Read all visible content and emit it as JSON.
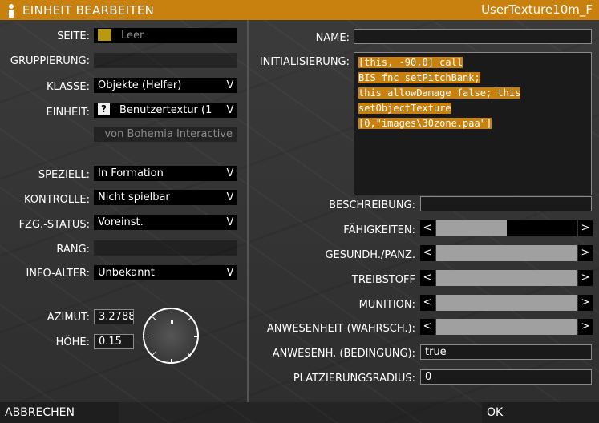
{
  "window": {
    "title": "EINHEIT BEARBEITEN",
    "object_name": "UserTexture10m_F",
    "accent_color": "#c8810e"
  },
  "left": {
    "seite": {
      "label": "SEITE:",
      "value": "Leer",
      "swatch_color": "#b89a10"
    },
    "gruppierung": {
      "label": "GRUPPIERUNG:",
      "value": ""
    },
    "klasse": {
      "label": "KLASSE:",
      "value": "Objekte (Helfer)"
    },
    "einheit": {
      "label": "EINHEIT:",
      "value": "Benutzertextur (1",
      "icon": "question-icon",
      "icon_glyph": "?"
    },
    "author": {
      "value": "von Bohemia Interactive"
    },
    "speziell": {
      "label": "SPEZIELL:",
      "value": "In Formation"
    },
    "kontrolle": {
      "label": "KONTROLLE:",
      "value": "Nicht spielbar"
    },
    "fzg_status": {
      "label": "FZG.-STATUS:",
      "value": "Voreinst."
    },
    "rang": {
      "label": "RANG:",
      "value": ""
    },
    "info_alter": {
      "label": "INFO-ALTER:",
      "value": "Unbekannt"
    },
    "azimut": {
      "label": "AZIMUT:",
      "value": "3.2788"
    },
    "hoehe": {
      "label": "HÖHE:",
      "value": "0.15"
    },
    "dropdown_glyph": "V"
  },
  "right": {
    "name": {
      "label": "NAME:",
      "value": ""
    },
    "initialisierung": {
      "label": "INITIALISIERUNG:",
      "lines": [
        "[this, -90,0] call BIS_fnc_setPitchBank;",
        "this allowDamage false; this",
        "setObjectTexture",
        "[0,\"images\\30zone.paa\"]"
      ]
    },
    "beschreibung": {
      "label": "BESCHREIBUNG:",
      "value": ""
    },
    "faehigkeiten": {
      "label": "FÄHIGKEITEN:",
      "level": 0.5
    },
    "gesundheit": {
      "label": "GESUNDH./PANZ.",
      "level": 1.0
    },
    "treibstoff": {
      "label": "TREIBSTOFF",
      "level": 1.0
    },
    "munition": {
      "label": "MUNITION:",
      "level": 1.0
    },
    "anwesenheit": {
      "label": "ANWESENHEIT (WAHRSCH.):",
      "level": 1.0
    },
    "anwesenh_bedingung": {
      "label": "ANWESENH. (BEDINGUNG):",
      "value": "true"
    },
    "platzierungsradius": {
      "label": "PLATZIERUNGSRADIUS:",
      "value": "0"
    },
    "arrow_left": "<",
    "arrow_right": ">"
  },
  "buttons": {
    "cancel": "ABBRECHEN",
    "ok": "OK"
  }
}
